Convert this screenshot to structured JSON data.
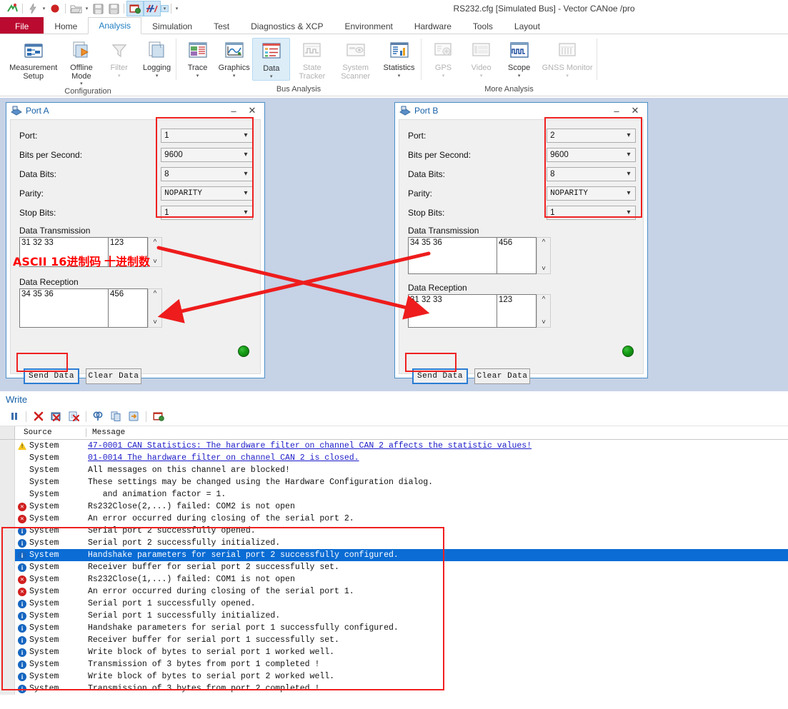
{
  "window": {
    "title": "RS232.cfg [Simulated Bus] - Vector CANoe /pro"
  },
  "quick_access": {
    "icons": [
      "canoe-logo-icon",
      "lightning-icon",
      "dropdown-caret-icon",
      "record-icon",
      "open-folder-icon",
      "dropdown-caret-icon",
      "save-icon",
      "save-as-icon",
      "config-icon",
      "measurement-icon",
      "dropdown-caret-icon",
      "customize-caret-icon"
    ]
  },
  "ribbon": {
    "tabs": [
      {
        "label": "File",
        "state": "file"
      },
      {
        "label": "Home",
        "state": "normal"
      },
      {
        "label": "Analysis",
        "state": "active"
      },
      {
        "label": "Simulation",
        "state": "normal"
      },
      {
        "label": "Test",
        "state": "normal"
      },
      {
        "label": "Diagnostics & XCP",
        "state": "normal"
      },
      {
        "label": "Environment",
        "state": "normal"
      },
      {
        "label": "Hardware",
        "state": "normal"
      },
      {
        "label": "Tools",
        "state": "normal"
      },
      {
        "label": "Layout",
        "state": "normal"
      }
    ],
    "groups": [
      {
        "name": "Configuration",
        "items": [
          {
            "label": "Measurement\nSetup",
            "icon": "measurement-setup-icon",
            "enabled": true,
            "dropdown": false,
            "selected": false
          },
          {
            "label": "Offline\nMode",
            "icon": "offline-mode-icon",
            "enabled": true,
            "dropdown": true,
            "selected": false
          },
          {
            "label": "Filter",
            "icon": "filter-icon",
            "enabled": false,
            "dropdown": true,
            "selected": false
          },
          {
            "label": "Logging",
            "icon": "logging-icon",
            "enabled": true,
            "dropdown": true,
            "selected": false
          }
        ]
      },
      {
        "name": "Bus Analysis",
        "items": [
          {
            "label": "Trace",
            "icon": "trace-icon",
            "enabled": true,
            "dropdown": true,
            "selected": false
          },
          {
            "label": "Graphics",
            "icon": "graphics-icon",
            "enabled": true,
            "dropdown": true,
            "selected": false
          },
          {
            "label": "Data",
            "icon": "data-icon",
            "enabled": true,
            "dropdown": true,
            "selected": true
          },
          {
            "label": "State\nTracker",
            "icon": "state-tracker-icon",
            "enabled": false,
            "dropdown": true,
            "selected": false
          },
          {
            "label": "System\nScanner",
            "icon": "system-scanner-icon",
            "enabled": false,
            "dropdown": true,
            "selected": false
          },
          {
            "label": "Statistics",
            "icon": "statistics-icon",
            "enabled": true,
            "dropdown": true,
            "selected": false
          }
        ]
      },
      {
        "name": "More Analysis",
        "items": [
          {
            "label": "GPS",
            "icon": "gps-icon",
            "enabled": false,
            "dropdown": true,
            "selected": false
          },
          {
            "label": "Video",
            "icon": "video-icon",
            "enabled": false,
            "dropdown": true,
            "selected": false
          },
          {
            "label": "Scope",
            "icon": "scope-icon",
            "enabled": true,
            "dropdown": true,
            "selected": false
          },
          {
            "label": "GNSS Monitor",
            "icon": "gnss-monitor-icon",
            "enabled": false,
            "dropdown": true,
            "selected": false
          }
        ]
      }
    ]
  },
  "port_a": {
    "title": "Port A",
    "minimize_label": "–",
    "close_label": "✕",
    "fields": [
      {
        "label": "Port:",
        "value": "1"
      },
      {
        "label": "Bits per Second:",
        "value": "9600"
      },
      {
        "label": "Data Bits:",
        "value": "8"
      },
      {
        "label": "Parity:",
        "value": "NOPARITY"
      },
      {
        "label": "Stop Bits:",
        "value": "1"
      }
    ],
    "transmission_label": "Data Transmission",
    "transmission_hex": "31 32 33",
    "transmission_dec": "123",
    "reception_label": "Data Reception",
    "reception_hex": "34 35 36",
    "reception_dec": "456",
    "send_button": "Send Data",
    "clear_button": "Clear Data",
    "annotation_hex": "ASCII 16进制码",
    "annotation_dec": "十进制数"
  },
  "port_b": {
    "title": "Port B",
    "minimize_label": "–",
    "close_label": "✕",
    "fields": [
      {
        "label": "Port:",
        "value": "2"
      },
      {
        "label": "Bits per Second:",
        "value": "9600"
      },
      {
        "label": "Data Bits:",
        "value": "8"
      },
      {
        "label": "Parity:",
        "value": "NOPARITY"
      },
      {
        "label": "Stop Bits:",
        "value": "1"
      }
    ],
    "transmission_label": "Data Transmission",
    "transmission_hex": "34 35 36",
    "transmission_dec": "456",
    "reception_label": "Data Reception",
    "reception_hex": "31 32 33",
    "reception_dec": "123",
    "send_button": "Send Data",
    "clear_button": "Clear Data"
  },
  "write": {
    "title": "Write",
    "toolbar_icons": [
      "pause-icon",
      "clear-icon",
      "clear-all-icon",
      "clear-page-icon",
      "find-icon",
      "copy-icon",
      "export-icon",
      "config-icon"
    ],
    "columns": {
      "source": "Source",
      "message": "Message"
    },
    "rows": [
      {
        "severity": "warning",
        "source": "System",
        "message": "47-0001 CAN Statistics: The hardware filter on channel CAN 2 affects the statistic values!",
        "link": true,
        "selected": false
      },
      {
        "severity": "dot",
        "source": "System",
        "message": "01-0014 The hardware filter on channel CAN 2 is closed.",
        "link": true,
        "selected": false
      },
      {
        "severity": "dot",
        "source": "System",
        "message": "All messages on this channel are blocked!",
        "link": false,
        "selected": false
      },
      {
        "severity": "dot",
        "source": "System",
        "message": "These settings may be changed using the Hardware Configuration dialog.",
        "link": false,
        "selected": false
      },
      {
        "severity": "dot",
        "source": "System",
        "message": "   and animation factor = 1.",
        "link": false,
        "selected": false
      },
      {
        "severity": "error",
        "source": "System",
        "message": "Rs232Close(2,...) failed: COM2 is not open",
        "link": false,
        "selected": false
      },
      {
        "severity": "error",
        "source": "System",
        "message": "An error occurred during closing of the serial port 2.",
        "link": false,
        "selected": false
      },
      {
        "severity": "info",
        "source": "System",
        "message": "Serial port 2 successfully opened.",
        "link": false,
        "selected": false
      },
      {
        "severity": "info",
        "source": "System",
        "message": "Serial port 2 successfully initialized.",
        "link": false,
        "selected": false
      },
      {
        "severity": "info",
        "source": "System",
        "message": "Handshake parameters for serial port 2 successfully configured.",
        "link": false,
        "selected": true
      },
      {
        "severity": "info",
        "source": "System",
        "message": "Receiver buffer for serial port 2 successfully set.",
        "link": false,
        "selected": false
      },
      {
        "severity": "error",
        "source": "System",
        "message": "Rs232Close(1,...) failed: COM1 is not open",
        "link": false,
        "selected": false
      },
      {
        "severity": "error",
        "source": "System",
        "message": "An error occurred during closing of the serial port 1.",
        "link": false,
        "selected": false
      },
      {
        "severity": "info",
        "source": "System",
        "message": "Serial port 1 successfully opened.",
        "link": false,
        "selected": false
      },
      {
        "severity": "info",
        "source": "System",
        "message": "Serial port 1 successfully initialized.",
        "link": false,
        "selected": false
      },
      {
        "severity": "info",
        "source": "System",
        "message": "Handshake parameters for serial port 1 successfully configured.",
        "link": false,
        "selected": false
      },
      {
        "severity": "info",
        "source": "System",
        "message": "Receiver buffer for serial port 1 successfully set.",
        "link": false,
        "selected": false
      },
      {
        "severity": "info",
        "source": "System",
        "message": "Write block of bytes to serial port 1 worked well.",
        "link": false,
        "selected": false
      },
      {
        "severity": "info",
        "source": "System",
        "message": "Transmission of 3 bytes from port 1 completed !",
        "link": false,
        "selected": false
      },
      {
        "severity": "info",
        "source": "System",
        "message": "Write block of bytes to serial port 2 worked well.",
        "link": false,
        "selected": false
      },
      {
        "severity": "info",
        "source": "System",
        "message": "Transmission of 3 bytes from port 2 completed !",
        "link": false,
        "selected": false
      }
    ]
  },
  "annotations": {
    "accent_red": "#ef2020",
    "highlight_blue": "#0a6cd4",
    "link_blue": "#1b1bc9"
  }
}
